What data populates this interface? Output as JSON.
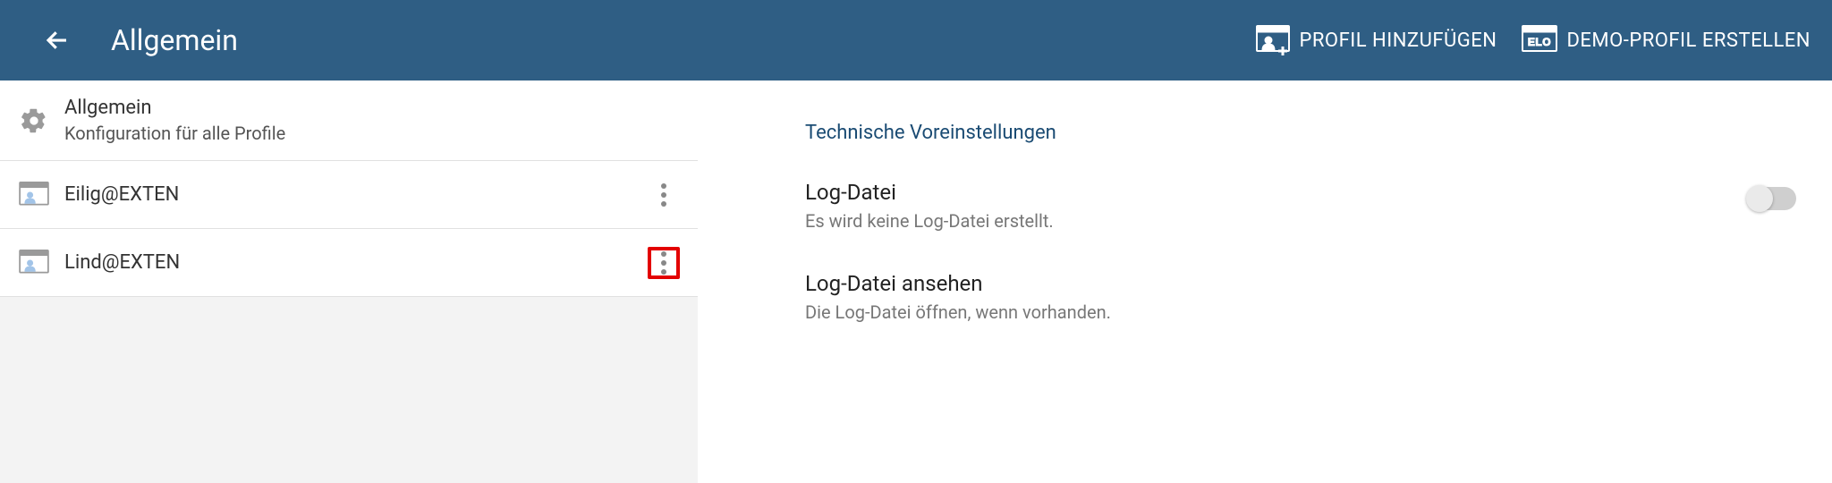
{
  "header": {
    "title": "Allgemein",
    "actions": {
      "add_profile": "PROFIL HINZUFÜGEN",
      "create_demo": "DEMO-PROFIL ERSTELLEN",
      "elo_label": "ELO"
    }
  },
  "left": {
    "general": {
      "title": "Allgemein",
      "subtitle": "Konfiguration für alle Profile"
    },
    "profiles": [
      {
        "name": "Eilig@EXTEN"
      },
      {
        "name": "Lind@EXTEN"
      }
    ]
  },
  "right": {
    "section_title": "Technische Voreinstellungen",
    "logfile": {
      "title": "Log-Datei",
      "subtitle": "Es wird keine Log-Datei erstellt.",
      "enabled": false
    },
    "viewlog": {
      "title": "Log-Datei ansehen",
      "subtitle": "Die Log-Datei öffnen, wenn vorhanden."
    }
  }
}
